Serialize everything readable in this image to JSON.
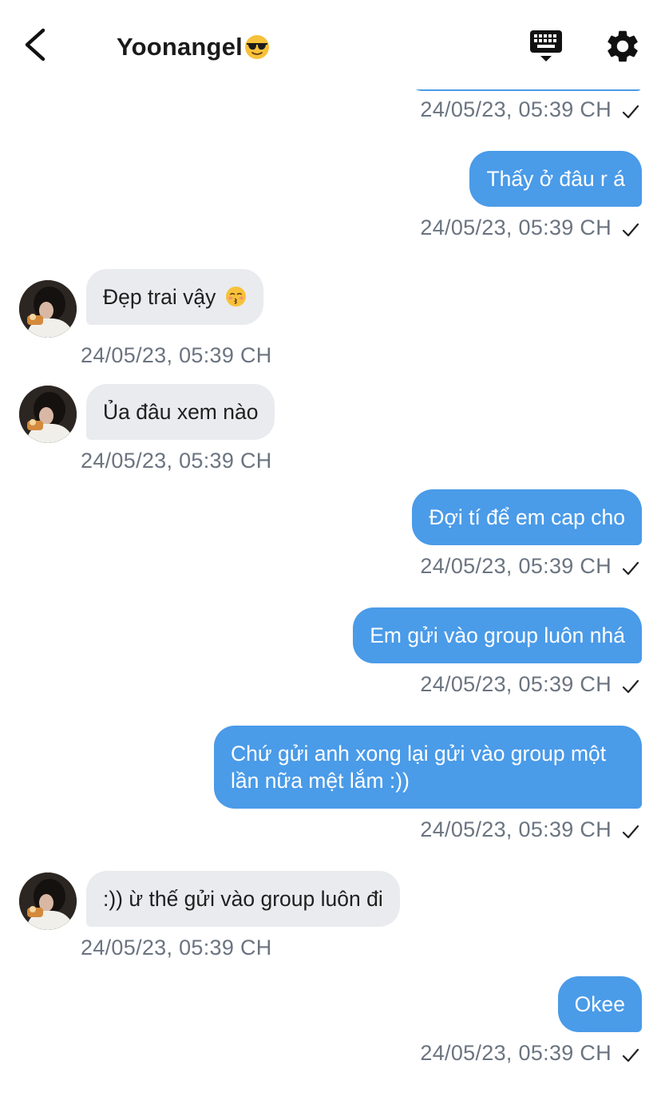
{
  "header": {
    "title": "Yoonangel",
    "title_emoji": "smiling-face-with-sunglasses",
    "back_icon": "chevron-left-icon",
    "keyboard_icon": "keyboard-icon",
    "settings_icon": "gear-icon"
  },
  "colors": {
    "outgoing_bubble": "#4a9be8",
    "incoming_bubble": "#e9ebee",
    "timestamp": "#6b7480"
  },
  "messages": [
    {
      "direction": "out",
      "text": "Thấy ở đâu r á",
      "time": "24/05/23, 05:39 CH",
      "status": "sent"
    },
    {
      "direction": "in",
      "text": "Đẹp trai vậy",
      "emoji": "kissing-face-with-smiling-eyes",
      "time": "24/05/23, 05:39 CH"
    },
    {
      "direction": "in",
      "text": "Ủa đâu xem nào",
      "time": "24/05/23, 05:39 CH"
    },
    {
      "direction": "out",
      "text": "Đợi tí để em cap cho",
      "time": "24/05/23, 05:39 CH",
      "status": "sent"
    },
    {
      "direction": "out",
      "text": "Em gửi vào group luôn nhá",
      "time": "24/05/23, 05:39 CH",
      "status": "sent"
    },
    {
      "direction": "out",
      "text": "Chứ gửi anh xong lại gửi vào group một lần nữa mệt lắm :))",
      "time": "24/05/23, 05:39 CH",
      "status": "sent"
    },
    {
      "direction": "in",
      "text": ":)) ừ thế gửi vào group luôn đi",
      "time": "24/05/23, 05:39 CH"
    },
    {
      "direction": "out",
      "text": "Okee",
      "time": "24/05/23, 05:39 CH",
      "status": "sent"
    }
  ],
  "previous_message": {
    "time": "24/05/23, 05:39 CH",
    "status": "sent"
  }
}
